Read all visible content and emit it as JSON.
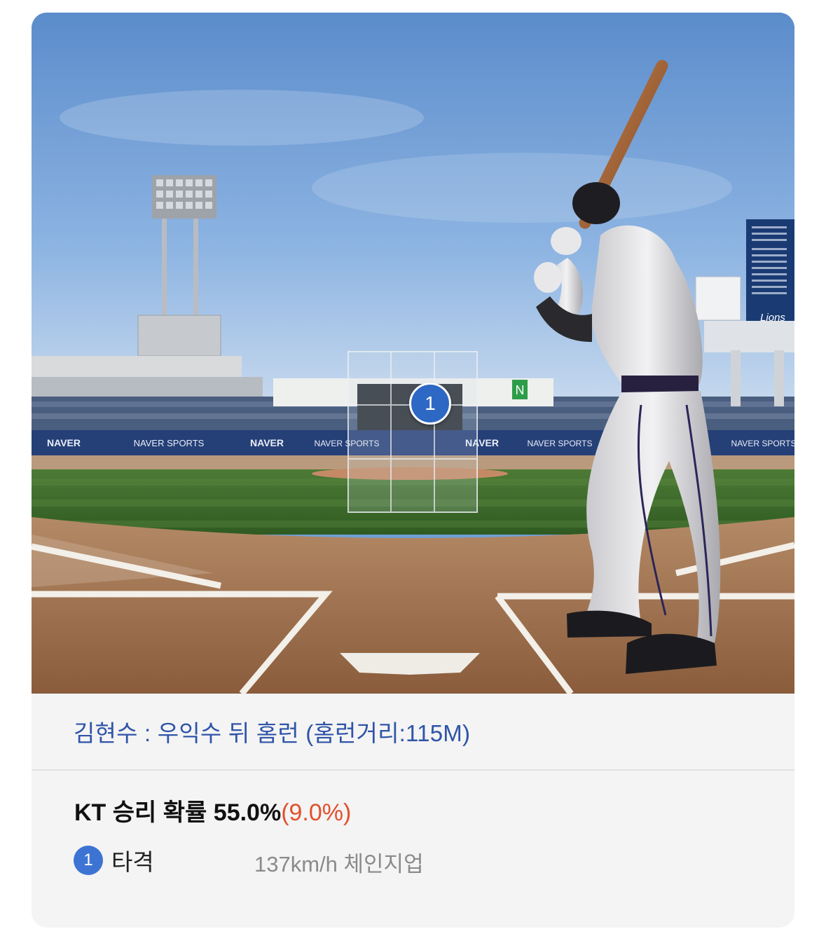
{
  "scene": {
    "ad_boards": [
      "NAVER",
      "NAVER SPORTS",
      "NAVER",
      "NAVER SPORTS",
      "NAVER",
      "NAVER SPORTS",
      "NAVER SPORTS"
    ],
    "scoreboard_team": "Lions",
    "green_logo": "N"
  },
  "pitch_marker": {
    "number": "1"
  },
  "result": {
    "text": "김현수 : 우익수 뒤 홈런 (홈런거리:115M)"
  },
  "win_probability": {
    "label": "KT 승리 확률 55.0%",
    "delta": "(9.0%)"
  },
  "pitch": {
    "number": "1",
    "type": "타격",
    "detail": "137km/h  체인지업"
  },
  "colors": {
    "result_text": "#2f54a8",
    "delta": "#e2502b",
    "marker": "#2d68c4"
  }
}
